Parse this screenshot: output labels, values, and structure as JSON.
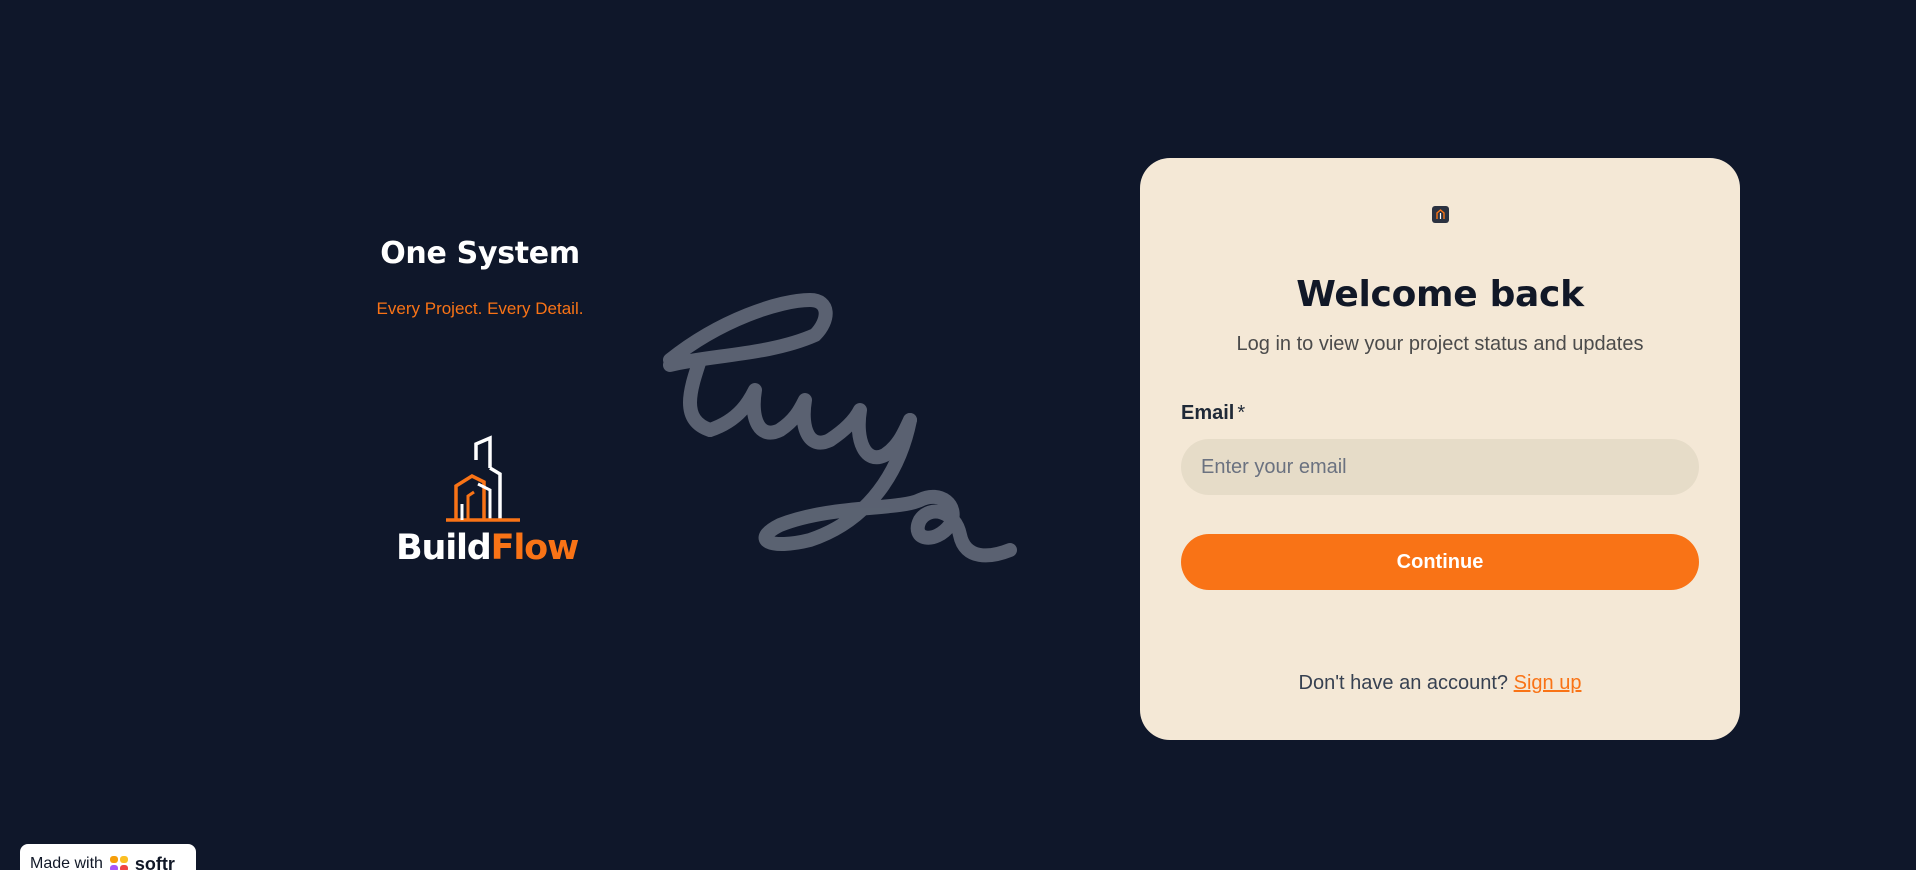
{
  "left_panel": {
    "title": "One System",
    "tagline": "Every Project. Every Detail.",
    "logo": {
      "icon": "building-icon",
      "word_part1": "Build",
      "word_part2": "Flow"
    }
  },
  "card": {
    "icon": "app-icon",
    "title": "Welcome back",
    "subtitle": "Log in to view your project status and updates",
    "email_label": "Email",
    "required_mark": "*",
    "email_value": "",
    "email_placeholder": "Enter your email",
    "continue_label": "Continue",
    "signup_prompt": "Don't have an account?",
    "signup_link": "Sign up"
  },
  "badge": {
    "text": "Made with",
    "brand": "softr",
    "icon": "softr-logo-icon"
  },
  "colors": {
    "background": "#0f172a",
    "accent": "#f97316",
    "card": "#f4e8d6",
    "input": "#e6dcc8"
  }
}
